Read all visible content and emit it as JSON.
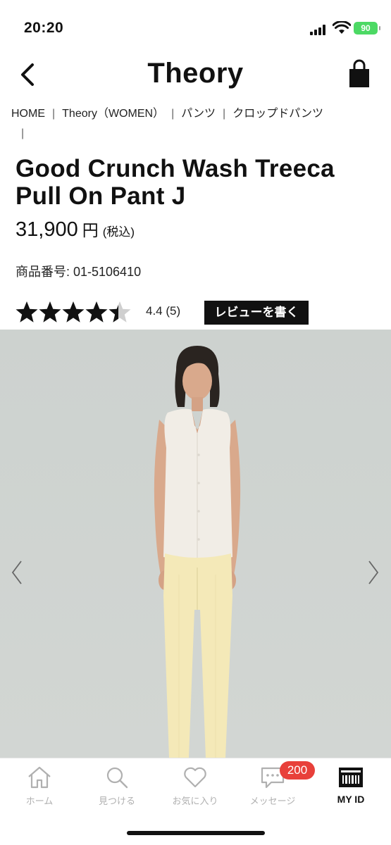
{
  "status_bar": {
    "time": "20:20",
    "battery": "90"
  },
  "header": {
    "brand": "Theory",
    "back_icon": "chevron-left-icon",
    "bag_icon": "shopping-bag-icon"
  },
  "breadcrumb": [
    {
      "label": "HOME"
    },
    {
      "label": "Theory（WOMEN）"
    },
    {
      "label": "パンツ"
    },
    {
      "label": "クロップドパンツ"
    }
  ],
  "product": {
    "title": "Good Crunch Wash Treeca Pull On Pant J",
    "price": "31,900",
    "price_unit": "円",
    "price_tax": "(税込)",
    "sku": "商品番号: 01-5106410"
  },
  "rating": {
    "stars_value": 4.4,
    "stars_max": 5,
    "text": "4.4  (5)",
    "review_button": "レビューを書く"
  },
  "gallery": {
    "prev_icon": "chevron-left-icon",
    "next_icon": "chevron-right-icon"
  },
  "colors": {
    "accent": "#111111",
    "badge": "#e8403a",
    "tab_inactive": "#b0b0b0",
    "battery": "#4cd964",
    "image_bg": "#cfd3d0",
    "pants": "#f4e9b8",
    "blouse": "#f1ede6"
  },
  "tab_bar": {
    "items": [
      {
        "label": "ホーム",
        "icon": "home-icon"
      },
      {
        "label": "見つける",
        "icon": "search-icon"
      },
      {
        "label": "お気に入り",
        "icon": "heart-icon"
      },
      {
        "label": "メッセージ",
        "icon": "message-icon",
        "badge": "200"
      },
      {
        "label": "MY ID",
        "icon": "barcode-card-icon"
      }
    ]
  }
}
